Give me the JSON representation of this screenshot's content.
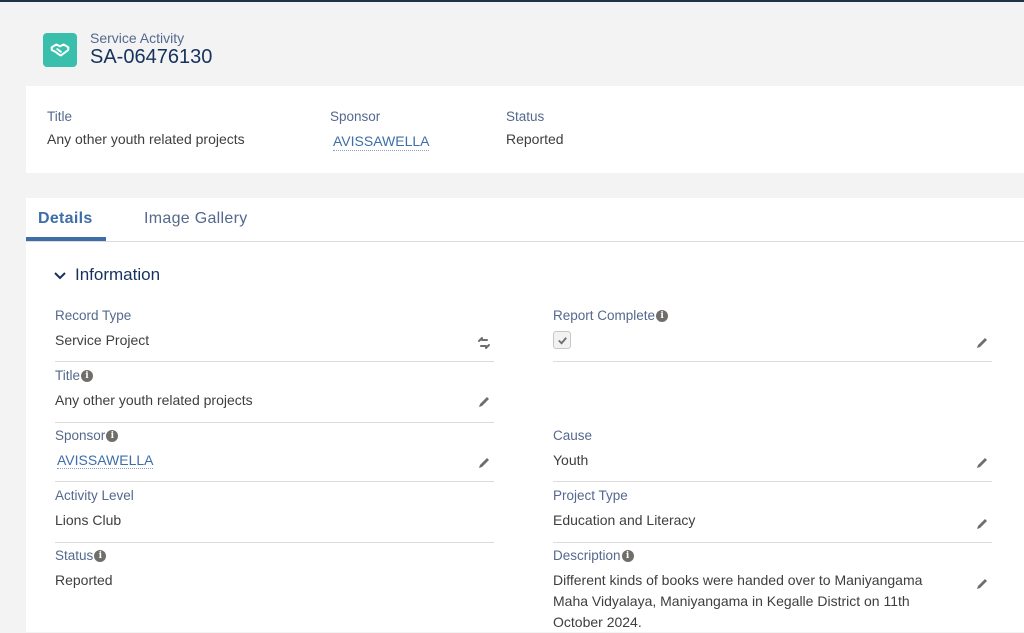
{
  "header": {
    "object_type": "Service Activity",
    "record_name": "SA-06476130",
    "icon": "handshake-icon"
  },
  "highlights": {
    "title_label": "Title",
    "title_value": "Any other youth related projects",
    "sponsor_label": "Sponsor",
    "sponsor_value": "AVISSAWELLA",
    "status_label": "Status",
    "status_value": "Reported"
  },
  "tabs": [
    {
      "label": "Details",
      "active": true
    },
    {
      "label": "Image Gallery",
      "active": false
    }
  ],
  "section": {
    "title": "Information"
  },
  "fields": {
    "record_type": {
      "label": "Record Type",
      "value": "Service Project"
    },
    "report_complete": {
      "label": "Report Complete",
      "checked": true
    },
    "title": {
      "label": "Title",
      "value": "Any other youth related projects"
    },
    "sponsor": {
      "label": "Sponsor",
      "value": "AVISSAWELLA"
    },
    "cause": {
      "label": "Cause",
      "value": "Youth"
    },
    "activity_level": {
      "label": "Activity Level",
      "value": "Lions Club"
    },
    "project_type": {
      "label": "Project Type",
      "value": "Education and Literacy"
    },
    "status": {
      "label": "Status",
      "value": "Reported"
    },
    "description": {
      "label": "Description",
      "value": "Different kinds of books were handed over to Maniyangama Maha Vidyalaya, Maniyangama in Kegalle District on 11th October 2024."
    }
  },
  "colors": {
    "brand_icon": "#3bbfad",
    "link": "#3d6ea8",
    "header_text": "#16325c"
  }
}
